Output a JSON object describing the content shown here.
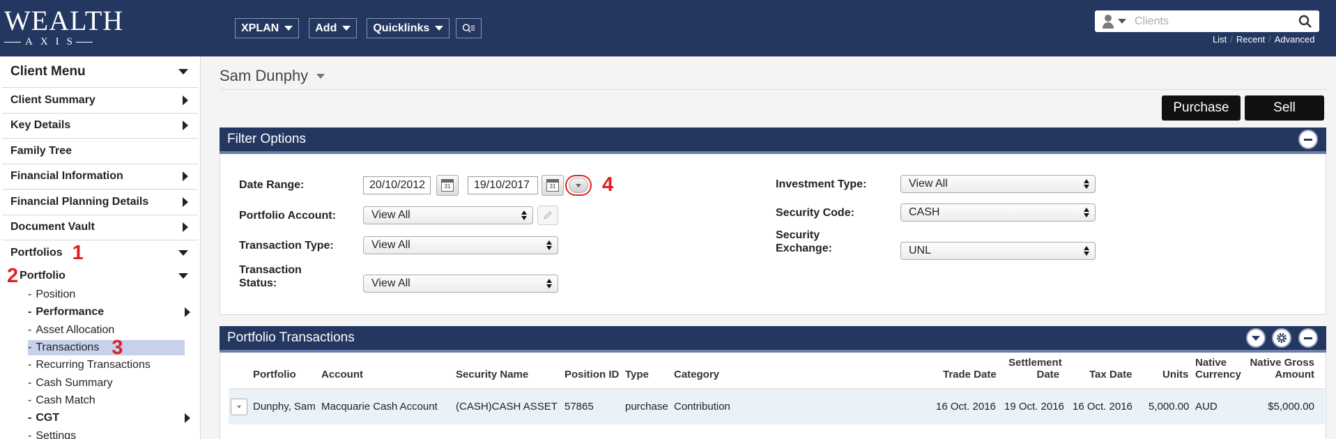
{
  "header": {
    "logo_top": "WEALTH",
    "logo_bottom": "AXIS",
    "nav": [
      {
        "label": "XPLAN"
      },
      {
        "label": "Add"
      },
      {
        "label": "Quicklinks"
      }
    ],
    "search": {
      "placeholder": "Clients"
    },
    "search_links": [
      "List",
      "Recent",
      "Advanced"
    ]
  },
  "sidebar": {
    "title": "Client Menu",
    "items": [
      {
        "label": "Client Summary"
      },
      {
        "label": "Key Details"
      },
      {
        "label": "Family Tree"
      },
      {
        "label": "Financial Information"
      },
      {
        "label": "Financial Planning Details"
      },
      {
        "label": "Document Vault"
      }
    ],
    "portfolios": {
      "label": "Portfolios",
      "marker": "1"
    },
    "portfolio": {
      "label": "Portfolio",
      "marker": "2"
    },
    "sub_items": [
      {
        "label": "Position",
        "bold": false
      },
      {
        "label": "Performance",
        "bold": true
      },
      {
        "label": "Asset Allocation",
        "bold": false
      },
      {
        "label": "Transactions",
        "bold": false,
        "marker": "3"
      },
      {
        "label": "Recurring Transactions",
        "bold": false
      },
      {
        "label": "Cash Summary",
        "bold": false
      },
      {
        "label": "Cash Match",
        "bold": false
      },
      {
        "label": "CGT",
        "bold": true
      },
      {
        "label": "Settings",
        "bold": false
      }
    ],
    "dash": "-"
  },
  "main": {
    "client_name": "Sam Dunphy",
    "purchase_label": "Purchase",
    "sell_label": "Sell",
    "filter": {
      "title": "Filter Options",
      "date_range_label": "Date Range:",
      "date_from": "20/10/2012",
      "date_to": "19/10/2017",
      "cal_text": "31",
      "marker": "4",
      "portfolio_account_label": "Portfolio Account:",
      "portfolio_account_value": "View All",
      "transaction_type_label": "Transaction Type:",
      "transaction_type_value": "View All",
      "transaction_status_label_1": "Transaction",
      "transaction_status_label_2": "Status:",
      "transaction_status_value": "View All",
      "investment_type_label": "Investment Type:",
      "investment_type_value": "View All",
      "security_code_label": "Security Code:",
      "security_code_value": "CASH",
      "security_exchange_label_1": "Security",
      "security_exchange_label_2": "Exchange:",
      "security_exchange_value": "UNL"
    },
    "transactions": {
      "title": "Portfolio Transactions",
      "columns": {
        "portfolio": "Portfolio",
        "account": "Account",
        "security_name": "Security Name",
        "position_id": "Position ID",
        "type": "Type",
        "category": "Category",
        "trade_date": "Trade Date",
        "settlement_date_1": "Settlement",
        "settlement_date_2": "Date",
        "tax_date": "Tax Date",
        "units": "Units",
        "native_currency_1": "Native",
        "native_currency_2": "Currency",
        "native_gross_1": "Native Gross",
        "native_gross_2": "Amount"
      },
      "rows": [
        {
          "portfolio": "Dunphy, Sam",
          "account": "Macquarie Cash Account",
          "security_name": "(CASH)CASH ASSET",
          "position_id": "57865",
          "type": "purchase",
          "category": "Contribution",
          "trade_date": "16 Oct. 2016",
          "settlement_date": "19 Oct. 2016",
          "tax_date": "16 Oct. 2016",
          "units": "5,000.00",
          "native_currency": "AUD",
          "native_gross_amount": "$5,000.00"
        }
      ]
    }
  }
}
